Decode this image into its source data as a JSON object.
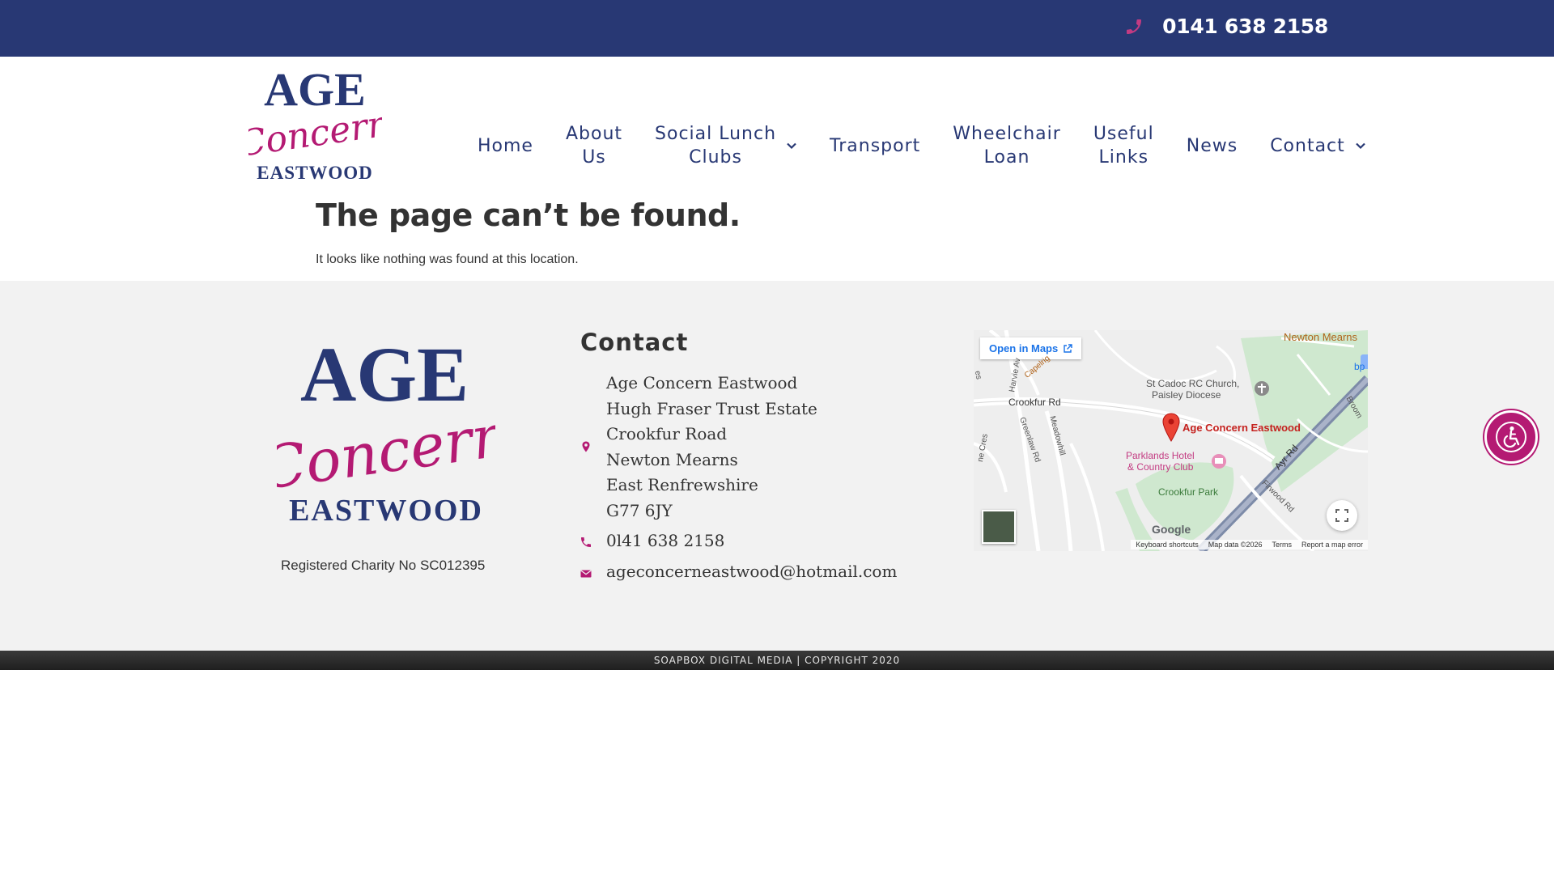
{
  "topbar": {
    "phone": "0141 638 2158"
  },
  "brand": {
    "line1": "AGE",
    "line2": "Concern",
    "line3": "EASTWOOD"
  },
  "nav": [
    {
      "label": "Home",
      "has_dropdown": false
    },
    {
      "label": "About\nUs",
      "has_dropdown": false
    },
    {
      "label": "Social Lunch\nClubs",
      "has_dropdown": true
    },
    {
      "label": "Transport",
      "has_dropdown": false
    },
    {
      "label": "Wheelchair\nLoan",
      "has_dropdown": false
    },
    {
      "label": "Useful\nLinks",
      "has_dropdown": false
    },
    {
      "label": "News",
      "has_dropdown": false
    },
    {
      "label": "Contact",
      "has_dropdown": true
    }
  ],
  "not_found": {
    "title": "The page can’t be found.",
    "text": "It looks like nothing was found at this location."
  },
  "footer": {
    "charity": "Registered Charity No SC012395",
    "contact_title": "Contact",
    "address": [
      "Age Concern Eastwood",
      "Hugh Fraser Trust Estate",
      "Crookfur Road",
      "Newton Mearns",
      "East Renfrewshire",
      "G77 6JY"
    ],
    "phone": "0l41 638 2158",
    "email": "ageconcerneastwood@hotmail.com"
  },
  "map": {
    "open_in_maps": "Open in Maps",
    "labels": {
      "newton_mearns": "Newton Mearns",
      "church": "St Cadoc RC Church,",
      "church2": "Paisley Diocese",
      "crookfur_rd": "Crookfur Rd",
      "place": "Age Concern Eastwood",
      "hotel": "Parklands Hotel",
      "hotel2": "& Country Club",
      "park": "Crookfur Park",
      "ayr_rd": "Ayr Rd",
      "firwood": "Firwood Rd",
      "greenlaw": "Greenlaw Rd",
      "meadowhill": "Meadowhill",
      "harvie": "Harvie Av",
      "capelrig": "Capelrig",
      "broom": "Broom",
      "bp": "bp",
      "cres": "ne Cres",
      "es": "es"
    },
    "google": "Google",
    "footer": {
      "shortcuts": "Keyboard shortcuts",
      "data": "Map data ©2026",
      "terms": "Terms",
      "report": "Report a map error"
    }
  },
  "copyright": "SOAPBOX DIGITAL MEDIA | COPYRIGHT 2020",
  "colors": {
    "navy": "#283874",
    "magenta": "#b41a73",
    "footer_bg": "#f2f2f2"
  },
  "icons": [
    "phone-icon",
    "chevron-down-icon",
    "map-pin-icon",
    "envelope-icon",
    "external-link-icon",
    "fullscreen-icon",
    "accessibility-icon"
  ]
}
